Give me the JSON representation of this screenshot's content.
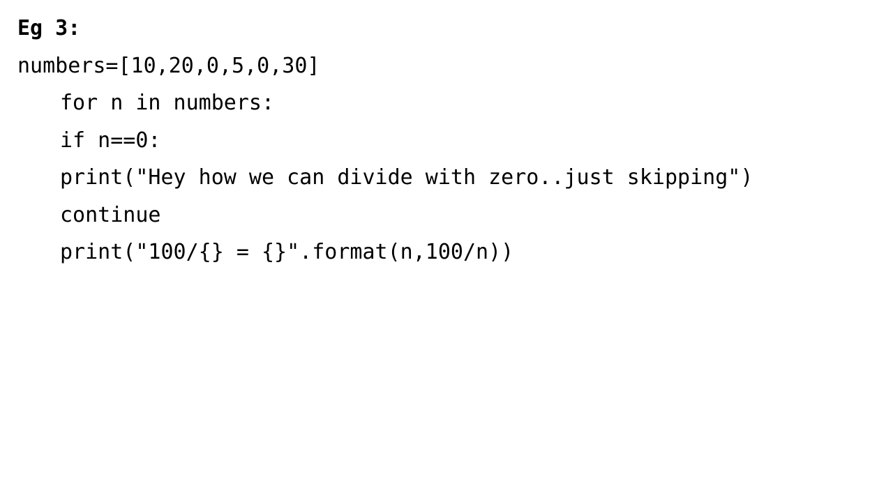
{
  "slide": {
    "heading": "Eg 3:",
    "code_lines": [
      "numbers=[10,20,0,5,0,30]",
      "for n in numbers:",
      "if n==0:",
      "print(\"Hey how we can divide with zero..just skipping\")",
      "continue",
      "print(\"100/{} = {}\".format(n,100/n))"
    ]
  }
}
